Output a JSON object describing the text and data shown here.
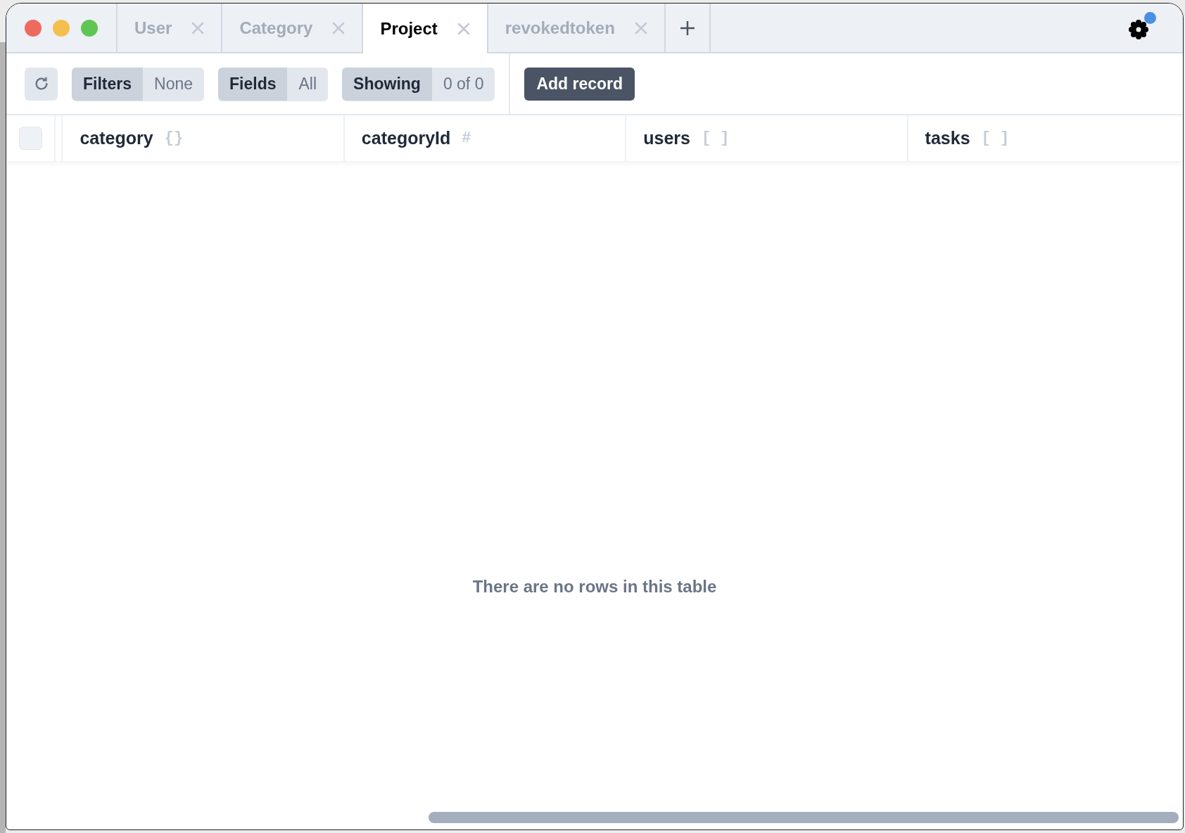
{
  "tabs": [
    {
      "label": "User",
      "selected": false
    },
    {
      "label": "Category",
      "selected": false
    },
    {
      "label": "Project",
      "selected": true
    },
    {
      "label": "revokedtoken",
      "selected": false
    }
  ],
  "settings": {
    "notification": true
  },
  "toolbar": {
    "filters": {
      "label": "Filters",
      "value": "None"
    },
    "fields": {
      "label": "Fields",
      "value": "All"
    },
    "showing": {
      "label": "Showing",
      "value": "0 of 0"
    },
    "add_button": "Add record"
  },
  "table": {
    "select_all_checked": false,
    "columns": [
      {
        "name": "category",
        "type_glyph": "{}"
      },
      {
        "name": "categoryId",
        "type_glyph": "#"
      },
      {
        "name": "users",
        "type_glyph": "[ ]"
      },
      {
        "name": "tasks",
        "type_glyph": "[ ]"
      }
    ],
    "empty_message": "There are no rows in this table"
  }
}
